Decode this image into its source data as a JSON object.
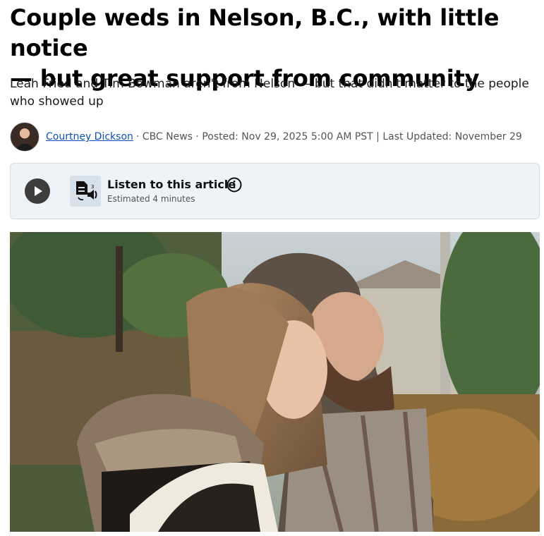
{
  "article": {
    "headline_line1": "Couple weds in Nelson, B.C., with little notice",
    "headline_line2": "— but great support from community",
    "deck_line1": "Leah Fried and Tim Bowman aren't from Nelson — but that didn't matter to the people",
    "deck_line2": "who showed up"
  },
  "byline": {
    "author": "Courtney Dickson",
    "meta": "· CBC News · Posted: Nov 29, 2025 5:00 AM PST | Last Updated: November 29"
  },
  "listen": {
    "title": "Listen to this article",
    "estimate": "Estimated 4 minutes",
    "play_icon": "play-icon",
    "tts_icon": "text-to-speech-icon",
    "info_icon": "info-icon"
  },
  "colors": {
    "author_link": "#0b52b8",
    "listen_bg": "#eef3f7",
    "play_button": "#3d3d3d"
  }
}
